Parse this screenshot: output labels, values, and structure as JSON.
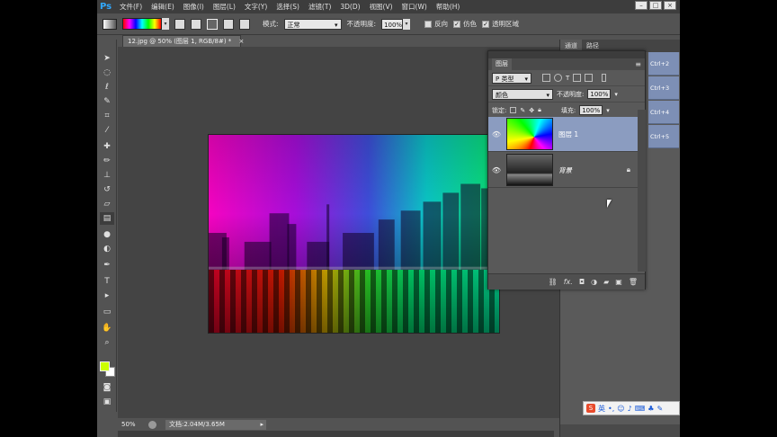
{
  "app": {
    "logo": "Ps"
  },
  "menu": [
    "文件(F)",
    "编辑(E)",
    "图像(I)",
    "图层(L)",
    "文字(Y)",
    "选择(S)",
    "滤镜(T)",
    "3D(D)",
    "视图(V)",
    "窗口(W)",
    "帮助(H)"
  ],
  "window_controls": [
    "–",
    "□",
    "×"
  ],
  "options": {
    "mode_label": "模式:",
    "mode_value": "正常",
    "opacity_label": "不透明度:",
    "opacity_value": "100%",
    "reverse_label": "反向",
    "dither_label": "仿色",
    "transparency_label": "透明区域",
    "reverse_checked": false,
    "dither_checked": true,
    "transparency_checked": true
  },
  "document": {
    "tab_title": "12.jpg @ 50% (图层 1, RGB/8#) *",
    "tab_close": "×"
  },
  "status": {
    "zoom": "50%",
    "doc_info": "文档:2.04M/3.65M"
  },
  "dock": {
    "tabs": [
      "通道",
      "路径"
    ],
    "history": [
      "Ctrl+2",
      "Ctrl+3",
      "Ctrl+4",
      "Ctrl+5"
    ]
  },
  "layers_panel": {
    "tab": "图层",
    "kind_filter": "P 类型",
    "blend_mode": "颜色",
    "opacity_label": "不透明度:",
    "opacity_value": "100%",
    "lock_label": "锁定:",
    "fill_label": "填充:",
    "fill_value": "100%",
    "layers": [
      {
        "name": "图层 1",
        "selected": true,
        "visible": true
      },
      {
        "name": "背景",
        "selected": false,
        "visible": true,
        "locked": true
      }
    ],
    "footer_icons": [
      "link-icon",
      "fx-icon",
      "mask-icon",
      "adjustment-icon",
      "group-icon",
      "new-layer-icon",
      "trash-icon"
    ],
    "footer_fx": "fx."
  },
  "ime": {
    "logo": "S",
    "mode": "英"
  },
  "colors": {
    "foreground": "#ccff00",
    "background": "#ffffff",
    "selected_layer": "#8b9cc0",
    "ps_blue": "#31a8ff"
  }
}
